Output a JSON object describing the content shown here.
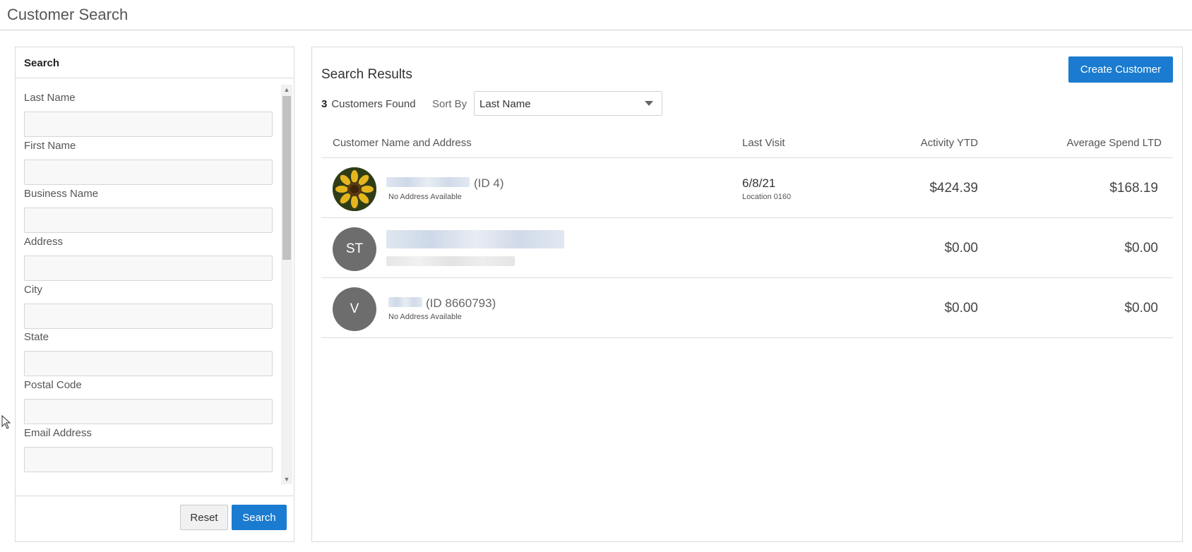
{
  "page": {
    "title": "Customer Search"
  },
  "search_panel": {
    "title": "Search",
    "fields": [
      {
        "label": "Last Name",
        "value": ""
      },
      {
        "label": "First Name",
        "value": ""
      },
      {
        "label": "Business Name",
        "value": ""
      },
      {
        "label": "Address",
        "value": ""
      },
      {
        "label": "City",
        "value": ""
      },
      {
        "label": "State",
        "value": ""
      },
      {
        "label": "Postal Code",
        "value": ""
      },
      {
        "label": "Email Address",
        "value": ""
      }
    ],
    "reset_label": "Reset",
    "search_label": "Search"
  },
  "results": {
    "title": "Search Results",
    "create_label": "Create Customer",
    "count": "3",
    "count_label": "Customers Found",
    "sort_label": "Sort By",
    "sort_value": "Last Name",
    "columns": {
      "name": "Customer Name and Address",
      "visit": "Last Visit",
      "activity": "Activity YTD",
      "avg": "Average Spend LTD"
    },
    "rows": [
      {
        "avatar": "sunflower-photo",
        "initials": "",
        "id_text": "(ID 4)",
        "address": "No Address Available",
        "last_visit": "6/8/21",
        "location": "Location 0160",
        "activity": "$424.39",
        "avg": "$168.19"
      },
      {
        "avatar": "initials",
        "initials": "ST",
        "id_text": "",
        "address": "",
        "last_visit": "",
        "location": "",
        "activity": "$0.00",
        "avg": "$0.00"
      },
      {
        "avatar": "initials",
        "initials": "V",
        "id_text": "(ID 8660793)",
        "address": "No Address Available",
        "last_visit": "",
        "location": "",
        "activity": "$0.00",
        "avg": "$0.00"
      }
    ]
  },
  "colors": {
    "primary": "#1a7bd0",
    "avatar_gray": "#6d6d6d",
    "border": "#d9d9d9"
  }
}
